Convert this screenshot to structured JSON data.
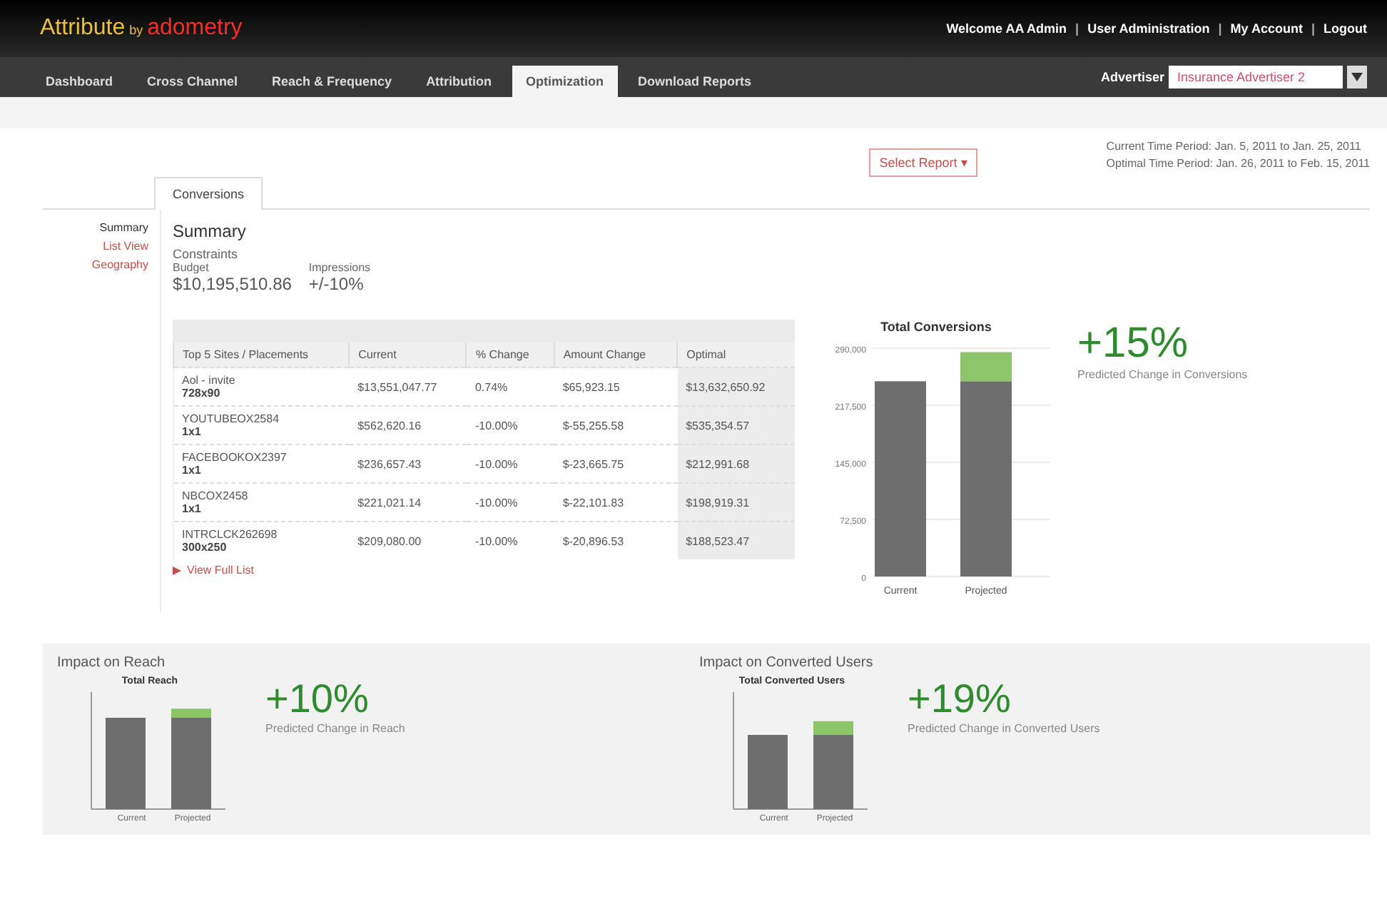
{
  "header": {
    "logo_main": "Attribute",
    "logo_by": "by",
    "logo_brand": "adometry",
    "separator": "|",
    "user_links": [
      "Welcome AA Admin",
      "User Administration",
      "My Account",
      "Logout"
    ],
    "advertiser_label": "Advertiser",
    "advertiser_value": "Insurance Advertiser 2"
  },
  "nav": [
    {
      "label": "Dashboard",
      "selected": false
    },
    {
      "label": "Cross Channel",
      "selected": false
    },
    {
      "label": "Reach & Frequency",
      "selected": false
    },
    {
      "label": "Attribution",
      "selected": false
    },
    {
      "label": "Optimization",
      "selected": true
    },
    {
      "label": "Download Reports",
      "selected": false
    }
  ],
  "select_report": "Select Report ▾",
  "time_periods": [
    "Current Time Period: Jan. 5, 2011 to Jan. 25, 2011",
    "Optimal Time Period: Jan. 26, 2011 to Feb. 15, 2011"
  ],
  "tabs": [
    {
      "label": "Conversions",
      "selected": true
    }
  ],
  "sidebar": [
    {
      "label": "Summary",
      "selected": true
    },
    {
      "label": "List View",
      "selected": false
    },
    {
      "label": "Geography",
      "selected": false
    }
  ],
  "summary": {
    "title": "Summary",
    "constraints_label": "Constraints",
    "budget_label": "Budget",
    "budget_value": "$10,195,510.86",
    "impressions_label": "Impressions",
    "impressions_value": "+/-10%"
  },
  "table": {
    "columns": [
      "Top 5 Sites / Placements",
      "Current",
      "% Change",
      "Amount Change",
      "Optimal"
    ],
    "rows": [
      {
        "site": "Aol - invite",
        "size": "728x90",
        "current": "$13,551,047.77",
        "pct": "0.74%",
        "amount": "$65,923.15",
        "optimal": "$13,632,650.92"
      },
      {
        "site": "YOUTUBEOX2584",
        "size": "1x1",
        "current": "$562,620.16",
        "pct": "-10.00%",
        "amount": "$-55,255.58",
        "optimal": "$535,354.57"
      },
      {
        "site": "FACEBOOKOX2397",
        "size": "1x1",
        "current": "$236,657.43",
        "pct": "-10.00%",
        "amount": "$-23,665.75",
        "optimal": "$212,991.68"
      },
      {
        "site": "NBCOX2458",
        "size": "1x1",
        "current": "$221,021.14",
        "pct": "-10.00%",
        "amount": "$-22,101.83",
        "optimal": "$198,919.31"
      },
      {
        "site": "INTRCLCK262698",
        "size": "300x250",
        "current": "$209,080.00",
        "pct": "-10.00%",
        "amount": "$-20,896.53",
        "optimal": "$188,523.47"
      }
    ],
    "view_full_list": "View Full List"
  },
  "main_chart": {
    "chart_data": {
      "type": "bar",
      "title": "Total Conversions",
      "categories": [
        "Current",
        "Projected"
      ],
      "stacked": true,
      "grid": true,
      "series": [
        {
          "color": "#6e6e6e",
          "values": [
            248000,
            248000
          ]
        },
        {
          "color": "#8cc56a",
          "values": [
            null,
            37000
          ]
        }
      ],
      "ylim": [
        0,
        290000
      ],
      "yticks": [
        {
          "value": 0,
          "label": "0"
        },
        {
          "value": 72500,
          "label": "72,500"
        },
        {
          "value": 145000,
          "label": "145,000"
        },
        {
          "value": 217500,
          "label": "217,500"
        },
        {
          "value": 290000,
          "label": "290,000"
        }
      ]
    },
    "change": "+15%",
    "change_label": "Predicted Change in Conversions"
  },
  "impacts": [
    {
      "title": "Impact on Reach",
      "chart_title": "Total Reach",
      "categories": [
        "Current",
        "Projected"
      ],
      "change": "+10%",
      "change_label": "Predicted Change in Reach"
    },
    {
      "title": "Impact on Converted Users",
      "chart_title": "Total Converted Users",
      "categories": [
        "Current",
        "Projected"
      ],
      "change": "+19%",
      "change_label": "Predicted Change in Converted Users"
    }
  ]
}
